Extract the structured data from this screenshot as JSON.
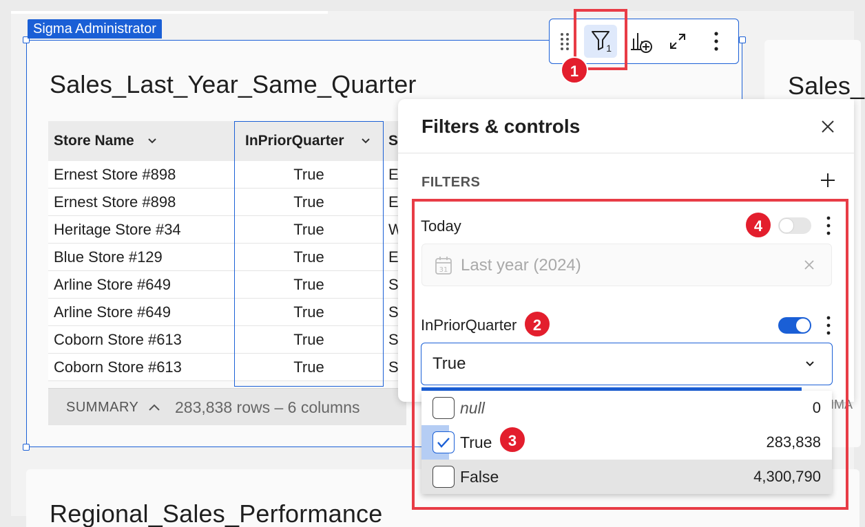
{
  "workspace": {
    "admin_tag": "Sigma Administrator",
    "main_card_title": "Sales_Last_Year_Same_Quarter",
    "right_card_title": "Sales_",
    "bottom_card_title": "Regional_Sales_Performance"
  },
  "toolbar": {
    "filter_count": "1",
    "icons": [
      "drag-handle-icon",
      "filter-icon",
      "add-chart-icon",
      "expand-icon",
      "more-vertical-icon"
    ]
  },
  "table": {
    "columns": [
      {
        "label": "Store Name"
      },
      {
        "label": "InPriorQuarter"
      },
      {
        "label": "S"
      }
    ],
    "rows": [
      {
        "store": "Ernest Store #898",
        "in_prior_quarter": "True",
        "third": "E"
      },
      {
        "store": "Ernest Store #898",
        "in_prior_quarter": "True",
        "third": "E"
      },
      {
        "store": "Heritage Store #34",
        "in_prior_quarter": "True",
        "third": "W"
      },
      {
        "store": "Blue Store #129",
        "in_prior_quarter": "True",
        "third": "E"
      },
      {
        "store": "Arline Store #649",
        "in_prior_quarter": "True",
        "third": "S"
      },
      {
        "store": "Arline Store #649",
        "in_prior_quarter": "True",
        "third": "S"
      },
      {
        "store": "Coborn Store #613",
        "in_prior_quarter": "True",
        "third": "S"
      },
      {
        "store": "Coborn Store #613",
        "in_prior_quarter": "True",
        "third": "S"
      }
    ],
    "summary_label": "SUMMARY",
    "summary_count": "283,838 rows – 6 columns"
  },
  "filters_panel": {
    "title": "Filters & controls",
    "section_label": "FILTERS",
    "today": {
      "label": "Today",
      "enabled": false,
      "value": "Last year (2024)"
    },
    "in_prior_quarter": {
      "label": "InPriorQuarter",
      "enabled": true,
      "selected": "True",
      "options": [
        {
          "label": "null",
          "count": "0",
          "checked": false
        },
        {
          "label": "True",
          "count": "283,838",
          "checked": true
        },
        {
          "label": "False",
          "count": "4,300,790",
          "checked": false
        }
      ]
    },
    "peek_text": "IMA"
  },
  "annotations": {
    "badges": [
      "1",
      "2",
      "3",
      "4"
    ],
    "color": "#e31e2d"
  },
  "colors": {
    "accent": "#1a5fd6",
    "annotation_red": "#e83c46"
  }
}
